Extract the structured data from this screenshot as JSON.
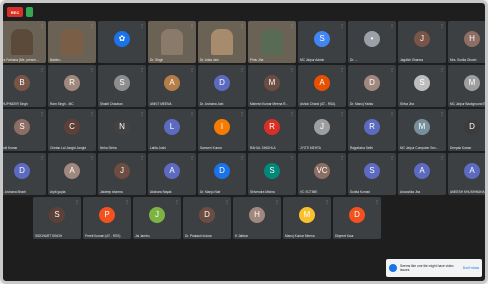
{
  "app": {
    "rec_label": "REC"
  },
  "rows": [
    [
      {
        "name": "Mrs Farhana (Me, presen...",
        "type": "video",
        "tone": "#5b4a3a"
      },
      {
        "name": "Baldev...",
        "type": "video",
        "tone": "#7b5e46"
      },
      {
        "name": "",
        "type": "avatar",
        "color": "#1a73e8",
        "initial": "✿"
      },
      {
        "name": "Dr. Singh",
        "type": "video",
        "tone": "#8a7a6a"
      },
      {
        "name": "Dr. Anita Jain",
        "type": "video",
        "tone": "#a68b6d"
      },
      {
        "name": "Pintu Jha",
        "type": "video",
        "tone": "#5a6b55"
      },
      {
        "name": "MC Jaipur Admin",
        "type": "avatar",
        "color": "#4285f4",
        "initial": "S"
      },
      {
        "name": "Dr. ...",
        "type": "avatar",
        "color": "#9aa0a6",
        "initial": "•"
      },
      {
        "name": "Jagdish Sharma",
        "type": "avatar",
        "color": "#795548",
        "initial": "J"
      },
      {
        "name": "Mrs. Sunita Ghosh",
        "type": "avatar",
        "color": "#8d6e63",
        "initial": "H"
      }
    ],
    [
      {
        "name": "BHUPINDER Singh",
        "type": "avatar",
        "color": "#795548",
        "initial": "B"
      },
      {
        "name": "Ram Singh - MC",
        "type": "avatar",
        "color": "#a1887f",
        "initial": "R"
      },
      {
        "name": "Shakti Chauhan",
        "type": "avatar",
        "color": "#8d8d8d",
        "initial": "S"
      },
      {
        "name": "ANKIT MEENA",
        "type": "avatar",
        "color": "#b57d47",
        "initial": "A"
      },
      {
        "name": "Dr. Archana Jain",
        "type": "avatar",
        "color": "#5c6bc0",
        "initial": "D"
      },
      {
        "name": "Mahesh Kumar Meena R...",
        "type": "avatar",
        "color": "#6d4c41",
        "initial": "M"
      },
      {
        "name": "Ashok Chand (AT - RSA)",
        "type": "avatar",
        "color": "#e65100",
        "initial": "A"
      },
      {
        "name": "Dr. Manoj Yadav",
        "type": "avatar",
        "color": "#a1887f",
        "initial": "D"
      },
      {
        "name": "Shiva Jha",
        "type": "avatar",
        "color": "#bdbdbd",
        "initial": "S"
      },
      {
        "name": "MC Jaipur Background E...",
        "type": "avatar",
        "color": "#9e9e9e",
        "initial": "M"
      }
    ],
    [
      {
        "name": "Sunil Kumar",
        "type": "avatar",
        "color": "#8d6e63",
        "initial": "S"
      },
      {
        "name": "Chetan Lal Jangid Jangid",
        "type": "avatar",
        "color": "#5d4037",
        "initial": "C"
      },
      {
        "name": "Neha Sinha",
        "type": "avatar",
        "color": "#424242",
        "initial": "N"
      },
      {
        "name": "Lalita Joshi",
        "type": "avatar",
        "color": "#5c6bc0",
        "initial": "L"
      },
      {
        "name": "Samveri Kumar",
        "type": "avatar",
        "color": "#f57c00",
        "initial": "I"
      },
      {
        "name": "RAHUL SINGHLA",
        "type": "avatar",
        "color": "#d93025",
        "initial": "R"
      },
      {
        "name": "JYOTI MEHTA",
        "type": "avatar",
        "color": "#9e9e9e",
        "initial": "J"
      },
      {
        "name": "Rajyaksha Sethi",
        "type": "avatar",
        "color": "#5c6bc0",
        "initial": "R"
      },
      {
        "name": "MC Jaipur Computer Sec...",
        "type": "avatar",
        "color": "#78909c",
        "initial": "M"
      },
      {
        "name": "Deepak Kumar",
        "type": "avatar",
        "color": "#3c3c3c",
        "initial": "D"
      }
    ],
    [
      {
        "name": "Dr. Archana Bharti",
        "type": "avatar",
        "color": "#5c6bc0",
        "initial": "D"
      },
      {
        "name": "Arpit gupta",
        "type": "avatar",
        "color": "#a1887f",
        "initial": "A"
      },
      {
        "name": "Jaideep sharma",
        "type": "avatar",
        "color": "#6d4c41",
        "initial": "J"
      },
      {
        "name": "Akshara Nayak",
        "type": "avatar",
        "color": "#5c6bc0",
        "initial": "A"
      },
      {
        "name": "Dr. Manju Nair",
        "type": "avatar",
        "color": "#1a73e8",
        "initial": "D"
      },
      {
        "name": "Shivendra Mishra",
        "type": "avatar",
        "color": "#00897b",
        "initial": "S"
      },
      {
        "name": "VC SCTIME",
        "type": "avatar",
        "color": "#8d6e63",
        "initial": "VC"
      },
      {
        "name": "Sunita Kumari",
        "type": "avatar",
        "color": "#5c6bc0",
        "initial": "S"
      },
      {
        "name": "Anoushka Jha",
        "type": "avatar",
        "color": "#5c6bc0",
        "initial": "A"
      },
      {
        "name": "ANEESH KHUSHWAHA",
        "type": "avatar",
        "color": "#5c6bc0",
        "initial": "A"
      }
    ],
    [
      {
        "name": "SIDDHART SINGH",
        "type": "avatar",
        "color": "#5d4037",
        "initial": "S"
      },
      {
        "name": "Preeti Kumari (AT - RSS)",
        "type": "avatar",
        "color": "#f4511e",
        "initial": "P"
      },
      {
        "name": "Jai Jambu",
        "type": "avatar",
        "color": "#7cb342",
        "initial": "J"
      },
      {
        "name": "Dr. Prakash Indora",
        "type": "avatar",
        "color": "#6d4c41",
        "initial": "D"
      },
      {
        "name": "H Jabbar",
        "type": "avatar",
        "color": "#a1887f",
        "initial": "H"
      },
      {
        "name": "Manoj Kumar Meena",
        "type": "avatar",
        "color": "#fbc02d",
        "initial": "M"
      },
      {
        "name": "Dilpreet Kaur",
        "type": "avatar",
        "color": "#f4511e",
        "initial": "D"
      }
    ]
  ],
  "toast": {
    "text": "Seems like one tile might have video issues",
    "action": "Don't show"
  }
}
